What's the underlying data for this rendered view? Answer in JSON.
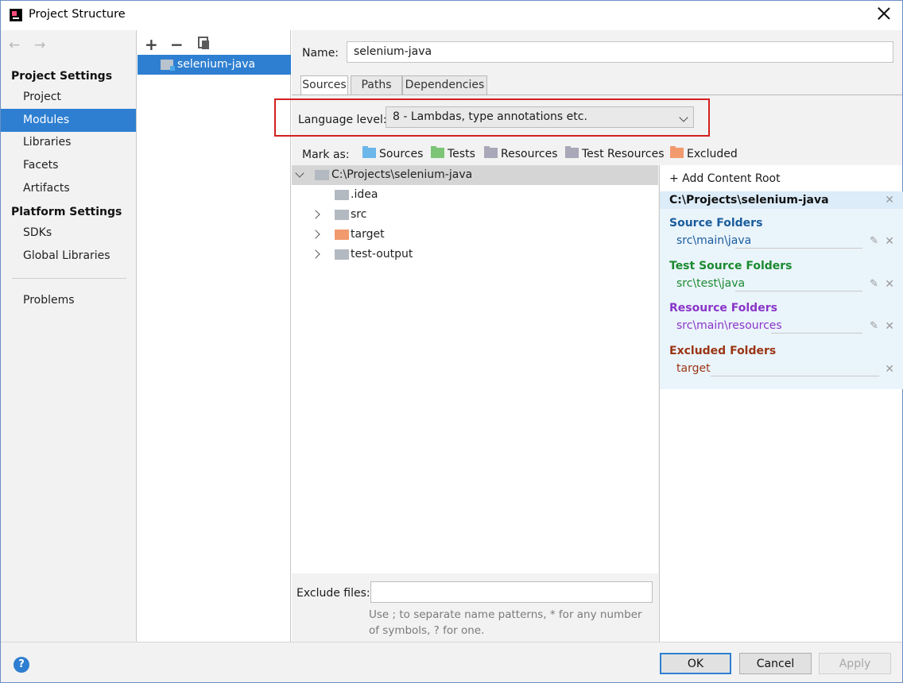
{
  "window": {
    "title": "Project Structure"
  },
  "sidebar": {
    "back_glyph": "←",
    "forward_glyph": "→",
    "project_settings_heading": "Project Settings",
    "project_items": [
      "Project",
      "Modules",
      "Libraries",
      "Facets",
      "Artifacts"
    ],
    "platform_settings_heading": "Platform Settings",
    "platform_items": [
      "SDKs",
      "Global Libraries"
    ],
    "problems_label": "Problems",
    "selected": "Modules"
  },
  "modules": {
    "add_glyph": "+",
    "remove_glyph": "−",
    "items": [
      "selenium-java"
    ]
  },
  "main": {
    "name_label": "Name:",
    "name_value": "selenium-java",
    "tabs": [
      "Sources",
      "Paths",
      "Dependencies"
    ],
    "active_tab": "Sources",
    "language_level_label": "Language level:",
    "language_level_value": "8 - Lambdas, type annotations etc.",
    "mark_as_label": "Mark as:",
    "mark_as_options": [
      "Sources",
      "Tests",
      "Resources",
      "Test Resources",
      "Excluded"
    ],
    "tree": {
      "root": "C:\\Projects\\selenium-java",
      "children": [
        ".idea",
        "src",
        "target",
        "test-output"
      ]
    },
    "content_root": {
      "add_label": "+ Add Content Root",
      "path": "C:\\Projects\\selenium-java",
      "source_folders_heading": "Source Folders",
      "source_folders_value": "src\\main\\java",
      "test_source_folders_heading": "Test Source Folders",
      "test_source_folders_value": "src\\test\\java",
      "resource_folders_heading": "Resource Folders",
      "resource_folders_value": "src\\main\\resources",
      "excluded_folders_heading": "Excluded Folders",
      "excluded_folders_value": "target"
    },
    "exclude_files_label": "Exclude files:",
    "exclude_files_value": "",
    "exclude_files_help": "Use ; to separate name patterns, * for any number of symbols, ? for one."
  },
  "footer": {
    "help_glyph": "?",
    "ok_label": "OK",
    "cancel_label": "Cancel",
    "apply_label": "Apply"
  },
  "colors": {
    "selection": "#2e7fd1",
    "sources": "#1a5c9c",
    "tests": "#1b8a30",
    "resources": "#8a35c9",
    "excluded": "#9a3514",
    "highlight_box": "#d42020"
  }
}
